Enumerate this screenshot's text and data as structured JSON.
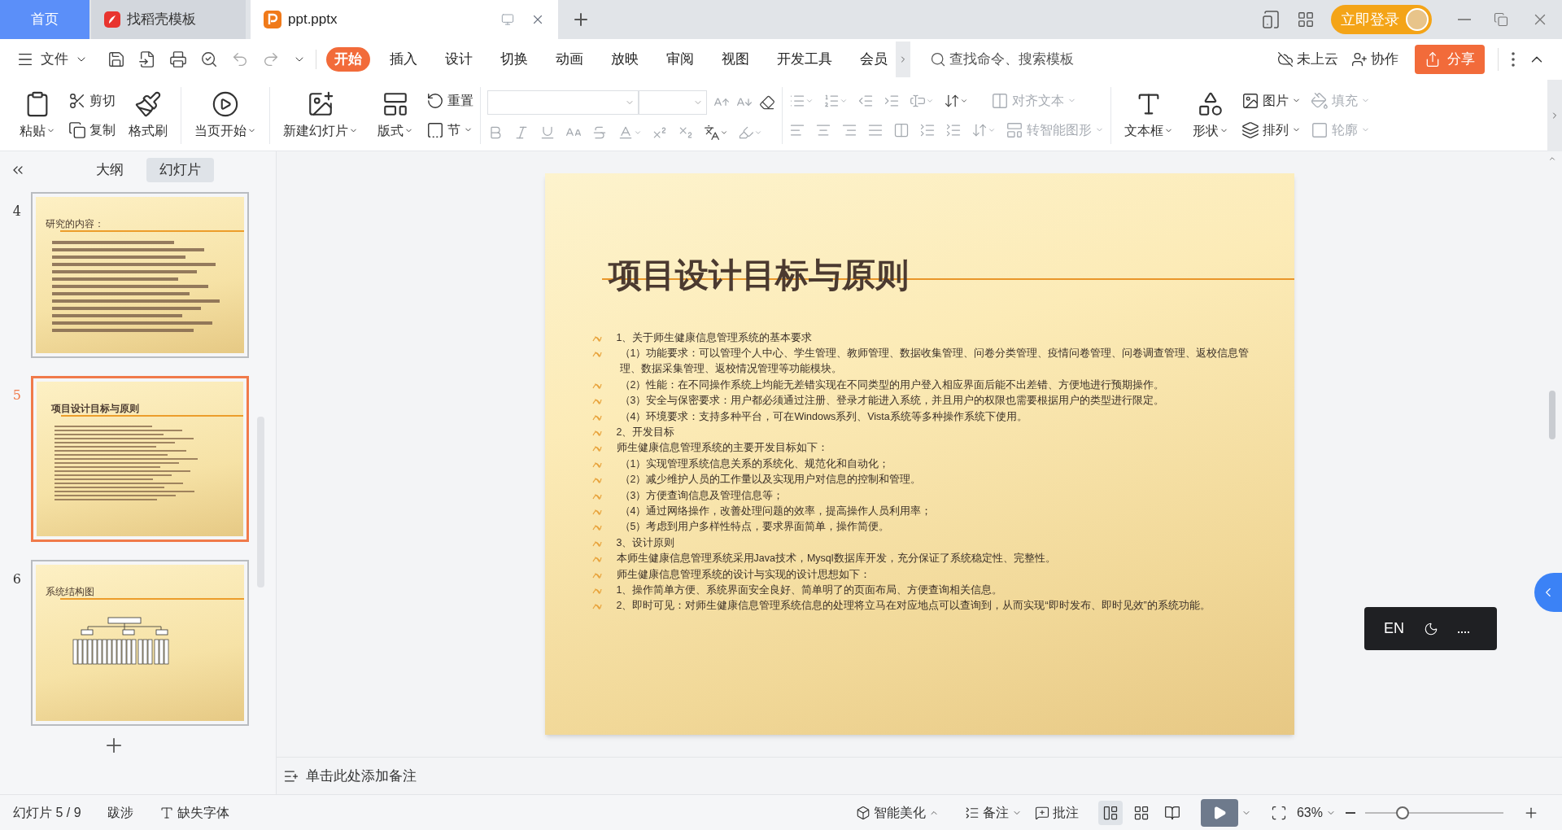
{
  "tabs": [
    {
      "label": "首页",
      "kind": "home",
      "selected": false
    },
    {
      "label": "找稻壳模板",
      "kind": "docer",
      "selected": false
    },
    {
      "label": "ppt.pptx",
      "kind": "doc",
      "selected": true
    }
  ],
  "titlebar": {
    "login": "立即登录"
  },
  "menu": {
    "file": "文件",
    "tabs": [
      {
        "label": "开始",
        "selected": true
      },
      {
        "label": "插入",
        "selected": false
      },
      {
        "label": "设计",
        "selected": false
      },
      {
        "label": "切换",
        "selected": false
      },
      {
        "label": "动画",
        "selected": false
      },
      {
        "label": "放映",
        "selected": false
      },
      {
        "label": "审阅",
        "selected": false
      },
      {
        "label": "视图",
        "selected": false
      },
      {
        "label": "开发工具",
        "selected": false
      },
      {
        "label": "会员",
        "selected": false
      }
    ],
    "search": {
      "placeholder": "查找命令、搜索模板"
    },
    "cloud": "未上云",
    "collab": "协作",
    "share": "分享"
  },
  "ribbon": {
    "paste": "粘贴",
    "cut": "剪切",
    "copy": "复制",
    "format_painter": "格式刷",
    "play": "当页开始",
    "new_slide": "新建幻灯片",
    "layout": "版式",
    "reset": "重置",
    "section": "节",
    "align_text": {
      "label": "对齐文本",
      "disabled": true
    },
    "smart_art": {
      "label": "转智能图形",
      "disabled": true
    },
    "text_box": "文本框",
    "shape": "形状",
    "picture": "图片",
    "arrange": "排列",
    "fill": {
      "label": "填充",
      "disabled": true
    },
    "outline": {
      "label": "轮廓",
      "disabled": true
    }
  },
  "panel": {
    "tabs": [
      {
        "label": "大纲",
        "selected": false
      },
      {
        "label": "幻灯片",
        "selected": true
      }
    ],
    "slides": [
      {
        "number": "4",
        "title": "研究的内容：",
        "kind": "text",
        "selected": false
      },
      {
        "number": "5",
        "title": "项目设计目标与原则",
        "kind": "text",
        "selected": true
      },
      {
        "number": "6",
        "title": "系统结构图",
        "kind": "diagram",
        "selected": false
      }
    ]
  },
  "slide": {
    "title": "项目设计目标与原则",
    "paragraphs": [
      {
        "text": "1、关于师生健康信息管理系统的基本要求",
        "kind": "plain"
      },
      {
        "text": "（1）功能要求：可以管理个人中心、学生管理、教师管理、数据收集管理、问卷分类管理、疫情问卷管理、问卷调查管理、返校信息管理、数据采集管理、返校情况管理等功能模块。",
        "kind": "item"
      },
      {
        "text": "（2）性能：在不同操作系统上均能无差错实现在不同类型的用户登入相应界面后能不出差错、方便地进行预期操作。",
        "kind": "item"
      },
      {
        "text": "（3）安全与保密要求：用户都必须通过注册、登录才能进入系统，并且用户的权限也需要根据用户的类型进行限定。",
        "kind": "item"
      },
      {
        "text": "（4）环境要求：支持多种平台，可在Windows系列、Vista系统等多种操作系统下使用。",
        "kind": "item"
      },
      {
        "text": "2、开发目标",
        "kind": "plain"
      },
      {
        "text": "师生健康信息管理系统的主要开发目标如下：",
        "kind": "plain"
      },
      {
        "text": "（1）实现管理系统信息关系的系统化、规范化和自动化；",
        "kind": "item"
      },
      {
        "text": "（2）减少维护人员的工作量以及实现用户对信息的控制和管理。",
        "kind": "item"
      },
      {
        "text": "（3）方便查询信息及管理信息等；",
        "kind": "item"
      },
      {
        "text": "（4）通过网络操作，改善处理问题的效率，提高操作人员利用率；",
        "kind": "item"
      },
      {
        "text": "（5）考虑到用户多样性特点，要求界面简单，操作简便。",
        "kind": "item"
      },
      {
        "text": "3、设计原则",
        "kind": "plain"
      },
      {
        "text": "本师生健康信息管理系统采用Java技术，Mysql数据库开发，充分保证了系统稳定性、完整性。",
        "kind": "plain"
      },
      {
        "text": "师生健康信息管理系统的设计与实现的设计思想如下：",
        "kind": "plain"
      },
      {
        "text": "1、操作简单方便、系统界面安全良好、简单明了的页面布局、方便查询相关信息。",
        "kind": "plain"
      },
      {
        "text": "2、即时可见：对师生健康信息管理系统信息的处理将立马在对应地点可以查询到，从而实现“即时发布、即时见效”的系统功能。",
        "kind": "plain"
      }
    ]
  },
  "notes": {
    "placeholder": "单击此处添加备注"
  },
  "ime": {
    "label": "EN"
  },
  "status": {
    "slide": "幻灯片 5 / 9",
    "theme": "跋涉",
    "missing_font": "缺失字体",
    "beautify": "智能美化",
    "notes": "备注",
    "comments": "批注",
    "view_modes": [
      {
        "selected": true
      },
      {
        "selected": false
      },
      {
        "selected": false
      }
    ],
    "zoom": "63%",
    "zoom_level": {
      "level": 0.27
    }
  }
}
